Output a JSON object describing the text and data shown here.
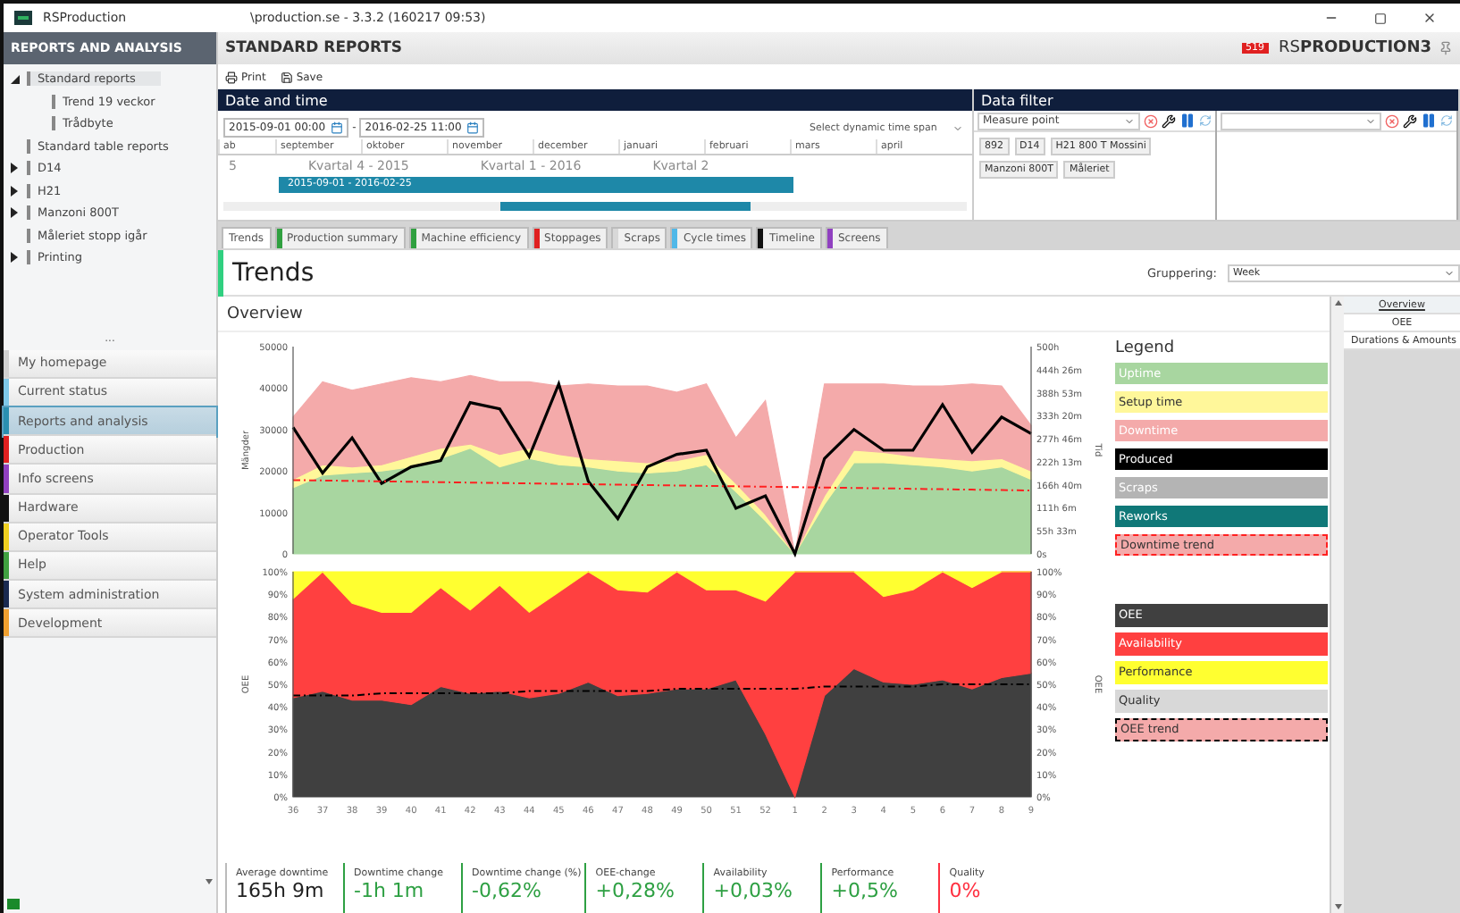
{
  "window": {
    "app_name": "RSProduction",
    "title": "\\production.se - 3.3.2 (160217 09:53)"
  },
  "sidebar": {
    "header": "REPORTS AND ANALYSIS",
    "tree": [
      {
        "label": "Standard reports",
        "expanded": true,
        "selected": true,
        "children": [
          {
            "label": "Trend 19 veckor",
            "selected": false
          },
          {
            "label": "Trådbyte",
            "selected": false
          }
        ]
      },
      {
        "label": "Standard table reports",
        "selected": false
      },
      {
        "label": "D14",
        "expanded": false,
        "selected": false
      },
      {
        "label": "H21",
        "expanded": false,
        "selected": false
      },
      {
        "label": "Manzoni 800T",
        "expanded": false,
        "selected": false
      },
      {
        "label": "Måleriet stopp igår",
        "selected": false
      },
      {
        "label": "Printing",
        "expanded": false,
        "selected": false
      }
    ],
    "splitter": "...",
    "nav": [
      {
        "label": "My homepage",
        "color": "#d0d0d0",
        "selected": false
      },
      {
        "label": "Current status",
        "color": "#7fc8e8",
        "selected": false
      },
      {
        "label": "Reports and analysis",
        "color": "#2a8fb0",
        "selected": true
      },
      {
        "label": "Production",
        "color": "#e02020",
        "selected": false
      },
      {
        "label": "Info screens",
        "color": "#9040c0",
        "selected": false
      },
      {
        "label": "Hardware",
        "color": "#111111",
        "selected": false
      },
      {
        "label": "Operator Tools",
        "color": "#f0d020",
        "selected": false
      },
      {
        "label": "Help",
        "color": "#40a040",
        "selected": false
      },
      {
        "label": "System administration",
        "color": "#1a2a50",
        "selected": false
      },
      {
        "label": "Development",
        "color": "#f0a030",
        "selected": false
      }
    ]
  },
  "header": {
    "title": "STANDARD REPORTS",
    "badge": "519",
    "brand_light": "RS",
    "brand_bold": "PRODUCTION3"
  },
  "toolbar": [
    "Print",
    "Save"
  ],
  "date_panel": {
    "title": "Date and time",
    "from": "2015-09-01 00:00",
    "separator": "-",
    "to": "2016-02-25 11:00",
    "dynamic_placeholder": "Select dynamic time span",
    "months": [
      "ab",
      "september",
      "oktober",
      "november",
      "december",
      "januari",
      "februari",
      "mars",
      "april"
    ],
    "quarters": [
      "5",
      "Kvartal 4 - 2015",
      "Kvartal 1 - 2016",
      "Kvartal 2"
    ],
    "range": "2015-09-01 - 2016-02-25"
  },
  "filter_panel": {
    "title": "Data filter",
    "columns": [
      {
        "placeholder": "Measure point",
        "chips": [
          "892",
          "D14",
          "H21 800 T Mossini",
          "Manzoni 800T",
          "Måleriet"
        ]
      },
      {}
    ]
  },
  "tabs": [
    {
      "label": "Trends",
      "selected": true
    },
    {
      "label": "Production summary",
      "color": "#30a040",
      "selected": false
    },
    {
      "label": "Machine efficiency",
      "color": "#30a040",
      "selected": false
    },
    {
      "label": "Stoppages",
      "color": "#e02020",
      "selected": false
    },
    {
      "label": "Scraps",
      "color": "#d8d8d8",
      "selected": false
    },
    {
      "label": "Cycle times",
      "color": "#50b8e8",
      "selected": false
    },
    {
      "label": "Timeline",
      "color": "#111111",
      "selected": false
    },
    {
      "label": "Screens",
      "color": "#9040c0",
      "selected": false
    }
  ],
  "page_title": "Trends",
  "grouping": {
    "label": "Gruppering:",
    "value": "Week"
  },
  "overview": {
    "title": "Overview",
    "top_chart": {
      "right_axis_label": "Tid",
      "right_ticks": [
        "500h",
        "444h 26m",
        "388h 53m",
        "333h 20m",
        "277h 46m",
        "222h 13m",
        "166h 40m",
        "111h 6m",
        "55h 33m",
        "0s"
      ],
      "chart_data": {
        "type": "area",
        "stacked": true,
        "ylabel": "Mängder",
        "ylim": [
          0,
          50000
        ],
        "yticks": [
          0,
          10000,
          20000,
          30000,
          40000,
          50000
        ],
        "series": [
          {
            "type": "area",
            "color": "#a8d6a0",
            "values": [
              16000,
              19000,
              19500,
              20000,
              21000,
              23000,
              25500,
              21000,
              23000,
              21500,
              21000,
              20000,
              19500,
              20000,
              21500,
              15000,
              8000,
              0,
              12000,
              22000,
              22000,
              21500,
              21000,
              20000,
              21000,
              18000
            ]
          },
          {
            "type": "area",
            "color": "#fff79a",
            "values": [
              2000,
              2500,
              1500,
              1500,
              2500,
              2500,
              1000,
              3000,
              2500,
              2500,
              2000,
              2500,
              2500,
              2500,
              2500,
              2000,
              1500,
              0,
              2000,
              3000,
              2500,
              2000,
              2000,
              2500,
              2000,
              2000
            ]
          },
          {
            "type": "area",
            "color": "#f4aaaa",
            "values": [
              15000,
              20000,
              18500,
              19500,
              19000,
              16000,
              16500,
              17500,
              16000,
              16500,
              18000,
              18000,
              18500,
              16500,
              17000,
              11000,
              27500,
              0,
              27000,
              16000,
              16500,
              17000,
              17500,
              18500,
              17500,
              11000
            ]
          },
          {
            "type": "line",
            "color": "#000000",
            "values": [
              30500,
              19500,
              28000,
              17000,
              21000,
              22500,
              36500,
              35000,
              23500,
              41000,
              17500,
              8500,
              21000,
              24000,
              25000,
              11000,
              14000,
              0,
              23000,
              30000,
              25000,
              25000,
              36000,
              24500,
              33000,
              29000
            ]
          },
          {
            "type": "line",
            "line_style": "dashed",
            "color": "#ff2020",
            "values": [
              17800,
              17700,
              17600,
              17500,
              17400,
              17300,
              17200,
              17100,
              17000,
              16900,
              16800,
              16700,
              16600,
              16500,
              16400,
              16300,
              16200,
              16100,
              16000,
              15900,
              15800,
              15700,
              15600,
              15500,
              15400,
              15300
            ]
          }
        ]
      }
    },
    "bottom_chart": {
      "right_axis_label": "OEE",
      "right_ticks": [
        "100%",
        "90%",
        "80%",
        "70%",
        "60%",
        "50%",
        "40%",
        "30%",
        "20%",
        "10%",
        "0%"
      ],
      "chart_data": {
        "type": "area",
        "stacked": true,
        "ylabel": "OEE",
        "ylim": [
          0,
          100
        ],
        "yticks": [
          {
            "value": 0,
            "label": "0%"
          },
          {
            "value": 10,
            "label": "10%"
          },
          {
            "value": 20,
            "label": "20%"
          },
          {
            "value": 30,
            "label": "30%"
          },
          {
            "value": 40,
            "label": "40%"
          },
          {
            "value": 50,
            "label": "50%"
          },
          {
            "value": 60,
            "label": "60%"
          },
          {
            "value": 70,
            "label": "70%"
          },
          {
            "value": 80,
            "label": "80%"
          },
          {
            "value": 90,
            "label": "90%"
          },
          {
            "value": 100,
            "label": "100%"
          }
        ],
        "categories": [
          "36",
          "37",
          "38",
          "39",
          "40",
          "41",
          "42",
          "43",
          "44",
          "45",
          "46",
          "47",
          "48",
          "49",
          "50",
          "51",
          "52",
          "1",
          "2",
          "3",
          "4",
          "5",
          "6",
          "7",
          "8",
          "9"
        ],
        "series": [
          {
            "type": "area",
            "color": "#404040",
            "values": [
              44,
              47,
              43,
              43,
              41,
              49,
              46,
              47,
              44,
              46,
              51,
              45,
              46,
              48,
              48,
              52,
              28,
              0,
              45,
              57,
              51,
              50,
              52,
              48,
              53,
              55
            ]
          },
          {
            "type": "area",
            "color": "#ff4040",
            "values": [
              44,
              53,
              43,
              39,
              41,
              44,
              37,
              47,
              38,
              45,
              49,
              47,
              45,
              52,
              44,
              40,
              59,
              100,
              55,
              43,
              38,
              42,
              48,
              45,
              47,
              45
            ]
          },
          {
            "type": "area",
            "color": "#ffff30",
            "values": [
              12,
              0,
              14,
              18,
              18,
              7,
              17,
              6,
              18,
              9,
              0,
              8,
              9,
              0,
              8,
              8,
              13,
              0,
              0,
              0,
              11,
              8,
              0,
              7,
              0,
              0
            ]
          },
          {
            "type": "line",
            "line_style": "dashed",
            "color": "#000000",
            "values": [
              45,
              45,
              45,
              46,
              46,
              46,
              46,
              46,
              47,
              47,
              47,
              47,
              47,
              48,
              48,
              48,
              48,
              48,
              49,
              49,
              49,
              49,
              50,
              50,
              50,
              50
            ]
          }
        ]
      }
    },
    "legend_title": "Legend",
    "legend_top": [
      {
        "label": "Uptime",
        "kind": "solid",
        "color": "#a8d6a0"
      },
      {
        "label": "Setup time",
        "kind": "solid",
        "color": "#fff79a"
      },
      {
        "label": "Downtime",
        "kind": "solid",
        "color": "#f4aaaa"
      },
      {
        "label": "Produced",
        "kind": "solid",
        "color": "#000000"
      },
      {
        "label": "Scraps",
        "kind": "solid",
        "color": "#b4b4b4"
      },
      {
        "label": "Reworks",
        "kind": "solid",
        "color": "#107878"
      },
      {
        "label": "Downtime trend",
        "kind": "dashed",
        "color": "#ff2020"
      }
    ],
    "legend_bottom": [
      {
        "label": "OEE",
        "kind": "solid",
        "color": "#404040"
      },
      {
        "label": "Availability",
        "kind": "solid",
        "color": "#ff4040"
      },
      {
        "label": "Performance",
        "kind": "solid",
        "color": "#ffff30"
      },
      {
        "label": "Quality",
        "kind": "solid",
        "color": "#d8d8d8"
      },
      {
        "label": "OEE trend",
        "kind": "dashed",
        "color": "#000000"
      }
    ],
    "kpis": [
      {
        "label": "Average downtime",
        "value": "165h 9m",
        "color": "#bbbbbb"
      },
      {
        "label": "Downtime change",
        "value": "-1h 1m",
        "color": "#2ea043"
      },
      {
        "label": "Downtime change (%)",
        "value": "-0,62%",
        "color": "#2ea043"
      },
      {
        "label": "OEE-change",
        "value": "+0,28%",
        "color": "#2ea043"
      },
      {
        "label": "Availability",
        "value": "+0,03%",
        "color": "#2ea043"
      },
      {
        "label": "Performance",
        "value": "+0,5%",
        "color": "#2ea043"
      },
      {
        "label": "Quality",
        "value": "0%",
        "color": "#ff3040"
      }
    ]
  },
  "side_panel": [
    {
      "label": "Overview",
      "selected": true
    },
    {
      "label": "OEE",
      "selected": false
    },
    {
      "label": "Durations & Amounts",
      "selected": false
    }
  ]
}
